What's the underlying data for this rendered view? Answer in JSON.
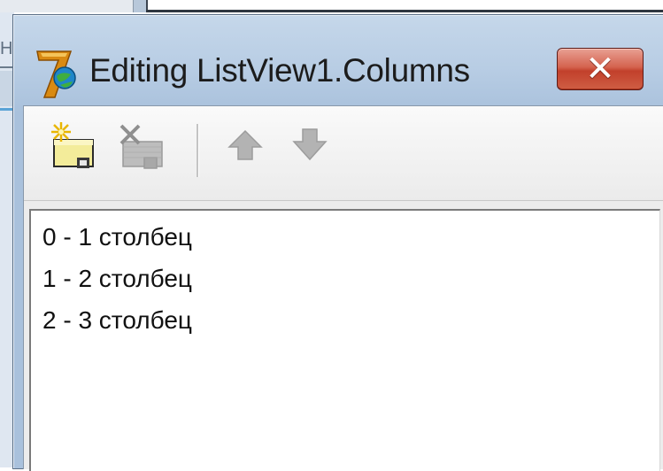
{
  "window": {
    "title": "Editing ListView1.Columns",
    "close_glyph": "✕"
  },
  "background": {
    "fragment_letter": "Н"
  },
  "icons": {
    "app": "delphi-app-icon",
    "close": "close-icon",
    "add": "add-new-icon",
    "delete": "delete-icon",
    "up": "move-up-arrow-icon",
    "down": "move-down-arrow-icon"
  },
  "toolbar": {
    "buttons": [
      {
        "name": "add-new",
        "enabled": true
      },
      {
        "name": "delete",
        "enabled": false
      },
      {
        "name": "move-up",
        "enabled": false
      },
      {
        "name": "move-down",
        "enabled": false
      }
    ]
  },
  "list": {
    "items": [
      "0 - 1 столбец",
      "1 - 2 столбец",
      "2 - 3 столбец"
    ]
  },
  "colors": {
    "titlebar": "#b8cde4",
    "close_button": "#c94a34",
    "client": "#ececec",
    "list_background": "#ffffff"
  }
}
